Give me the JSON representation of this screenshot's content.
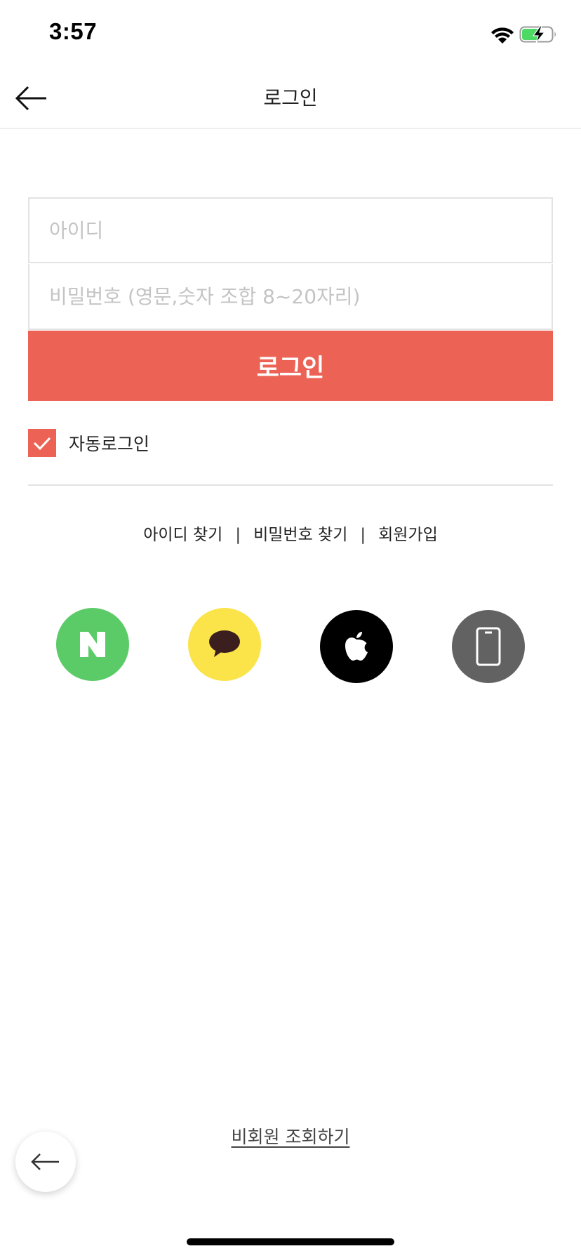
{
  "status_bar": {
    "time": "3:57",
    "icons": [
      "wifi-icon",
      "battery-charging-icon"
    ]
  },
  "nav": {
    "title": "로그인",
    "back_icon": "arrow-left-icon"
  },
  "form": {
    "id_placeholder": "아이디",
    "password_placeholder": "비밀번호 (영문,숫자 조합 8~20자리)",
    "login_label": "로그인",
    "auto_login_label": "자동로그인",
    "auto_login_checked": true
  },
  "links": {
    "find_id": "아이디 찾기",
    "find_password": "비밀번호 찾기",
    "signup": "회원가입",
    "separator": "|"
  },
  "social_logins": [
    {
      "name": "naver",
      "icon": "naver-icon",
      "color": "#5bcb67",
      "letter": "N"
    },
    {
      "name": "kakao",
      "icon": "kakao-talk-icon",
      "color": "#fbe34a"
    },
    {
      "name": "apple",
      "icon": "apple-icon",
      "color": "#000000"
    },
    {
      "name": "phone",
      "icon": "phone-icon",
      "color": "#626262"
    }
  ],
  "guest_lookup_label": "비회원 조회하기",
  "colors": {
    "accent": "#ec6356"
  }
}
